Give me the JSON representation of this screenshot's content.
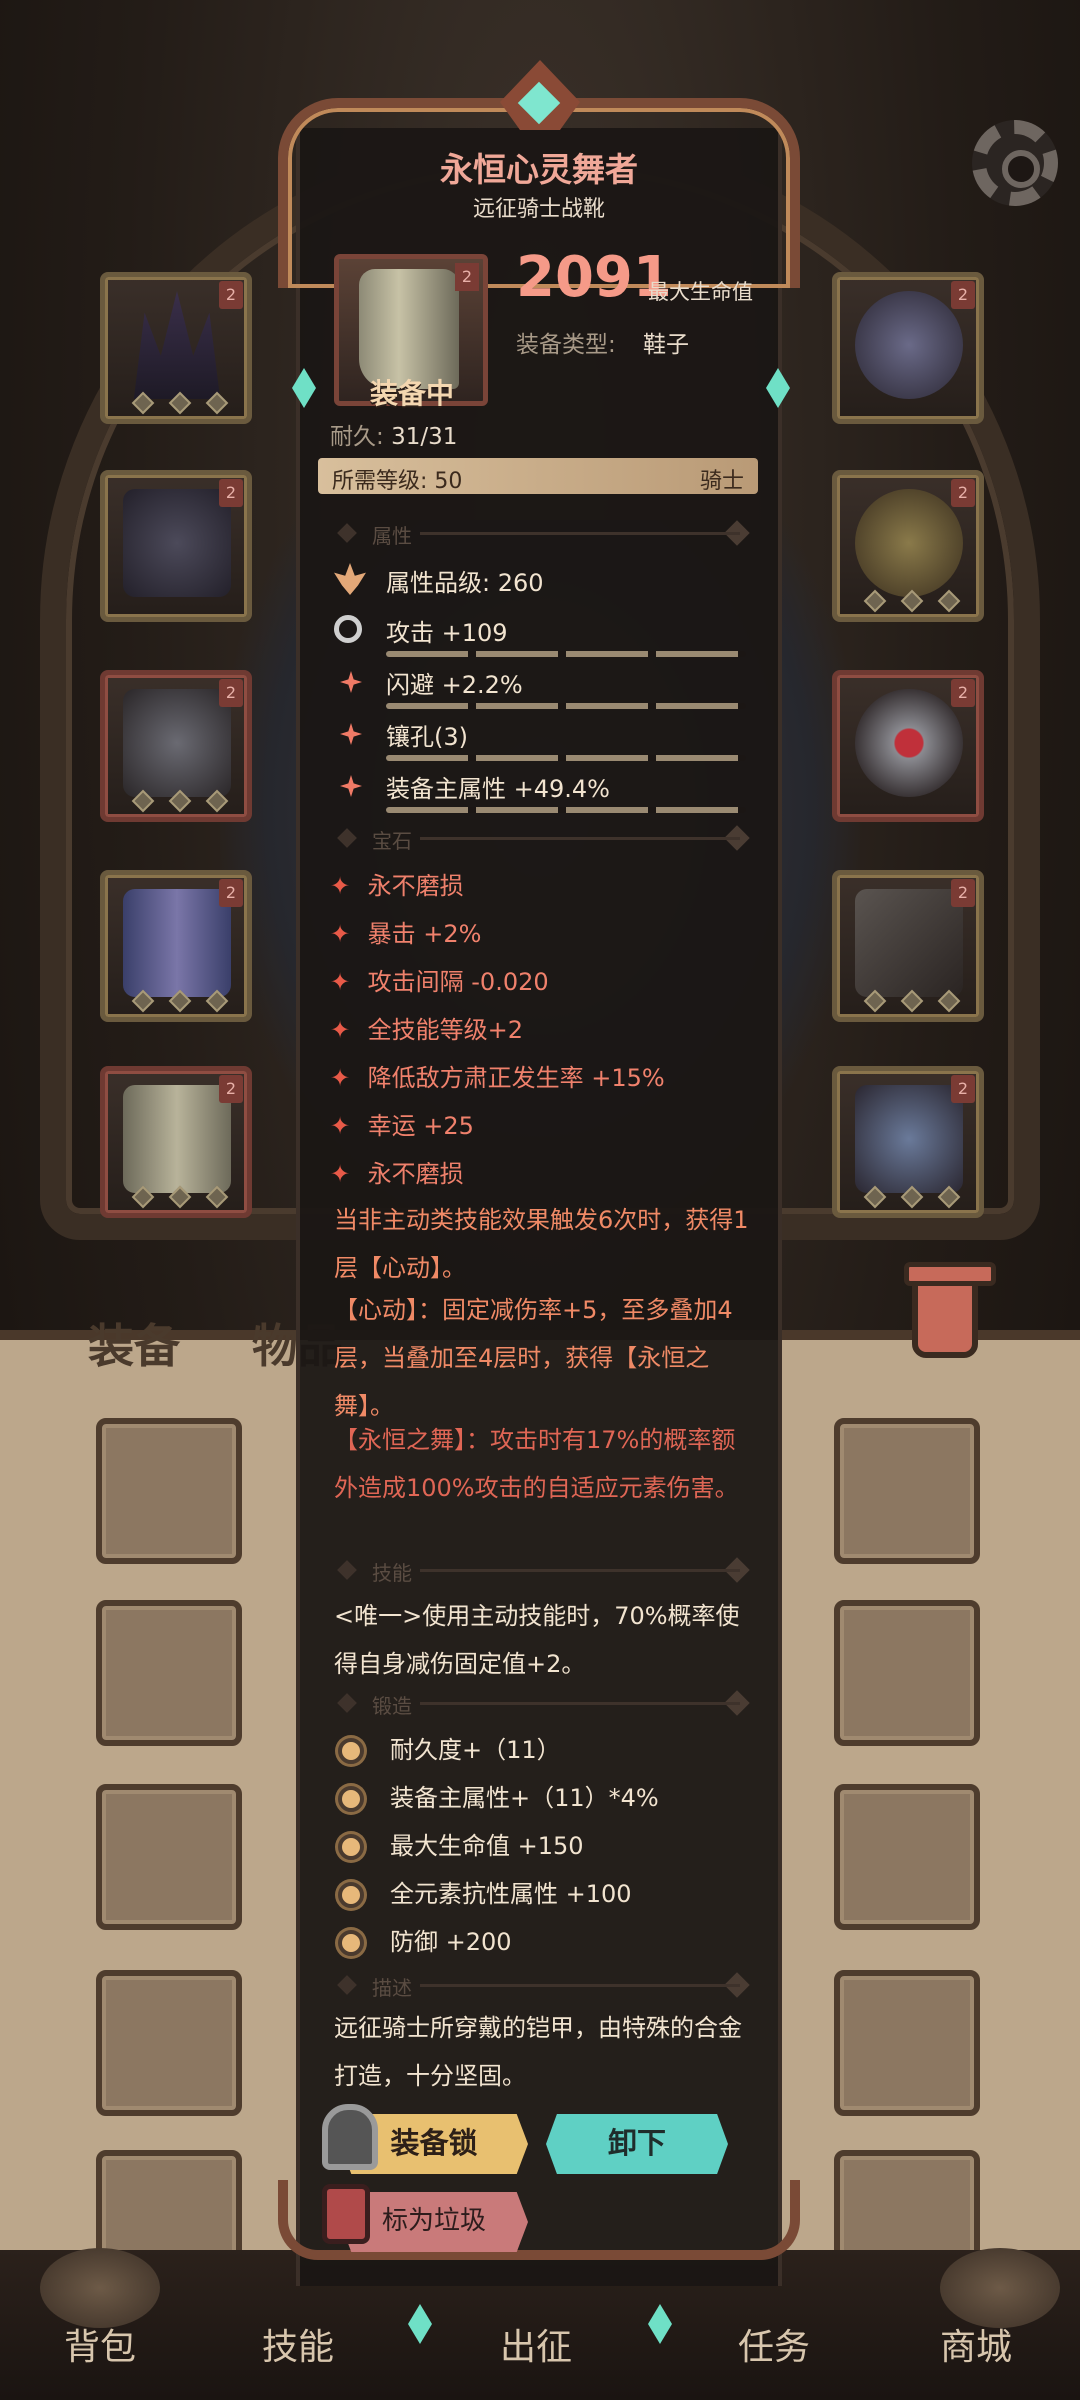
{
  "item": {
    "name": "永恒心灵舞者",
    "subtitle": "远征骑士战靴",
    "badge": "2",
    "status": "装备中",
    "main_stat_value": "2091",
    "main_stat_label": "最大生命值",
    "type_label": "装备类型:",
    "type_value": "鞋子",
    "durability_label": "耐久:",
    "durability_value": "31/31",
    "req_level": "所需等级: 50",
    "req_class": "骑士"
  },
  "sections": {
    "attributes": "属性",
    "gems": "宝石",
    "skill": "技能",
    "forge": "锻造",
    "description": "描述"
  },
  "attributes": [
    "属性品级: 260",
    "攻击 +109",
    "闪避 +2.2%",
    "镶孔(3)",
    "装备主属性 +49.4%"
  ],
  "gems": [
    "永不磨损",
    "暴击 +2%",
    "攻击间隔 -0.020",
    "全技能等级+2",
    "降低敌方肃正发生率 +15%",
    "幸运 +25",
    "永不磨损"
  ],
  "set_effect": {
    "p1": "当非主动类技能效果触发6次时，获得1层【心动】。",
    "p2": "【心动】：固定减伤率+5，至多叠加4层，当叠加至4层时，获得【永恒之舞】。",
    "p3": "【永恒之舞】：攻击时有17%的概率额外造成100%攻击的自适应元素伤害。"
  },
  "skill_text": "<唯一>使用主动技能时，70%概率使得自身减伤固定值+2。",
  "forge": [
    "耐久度+（11）",
    "装备主属性+（11）*4%",
    "最大生命值 +150",
    "全元素抗性属性 +100",
    "防御 +200"
  ],
  "description_text": "远征骑士所穿戴的铠甲，由特殊的合金打造，十分坚固。",
  "buttons": {
    "lock": "装备锁",
    "unequip": "卸下",
    "junk": "标为垃圾"
  },
  "background_tabs": {
    "equipment": "装备",
    "items": "物品"
  },
  "slot_badge": "2",
  "bottom_nav": [
    "背包",
    "技能",
    "出征",
    "任务",
    "商城"
  ],
  "colors": {
    "title": "#f0a898",
    "main_stat": "#f59a88",
    "gem_text": "#f0816c",
    "lock_button": "#e8c070",
    "unequip_button": "#5fd0c4",
    "junk_button": "#c97a7a"
  },
  "icons": {
    "settings": "gear-icon",
    "trash": "trash-icon",
    "lock": "lock-icon",
    "junk": "junk-icon"
  }
}
